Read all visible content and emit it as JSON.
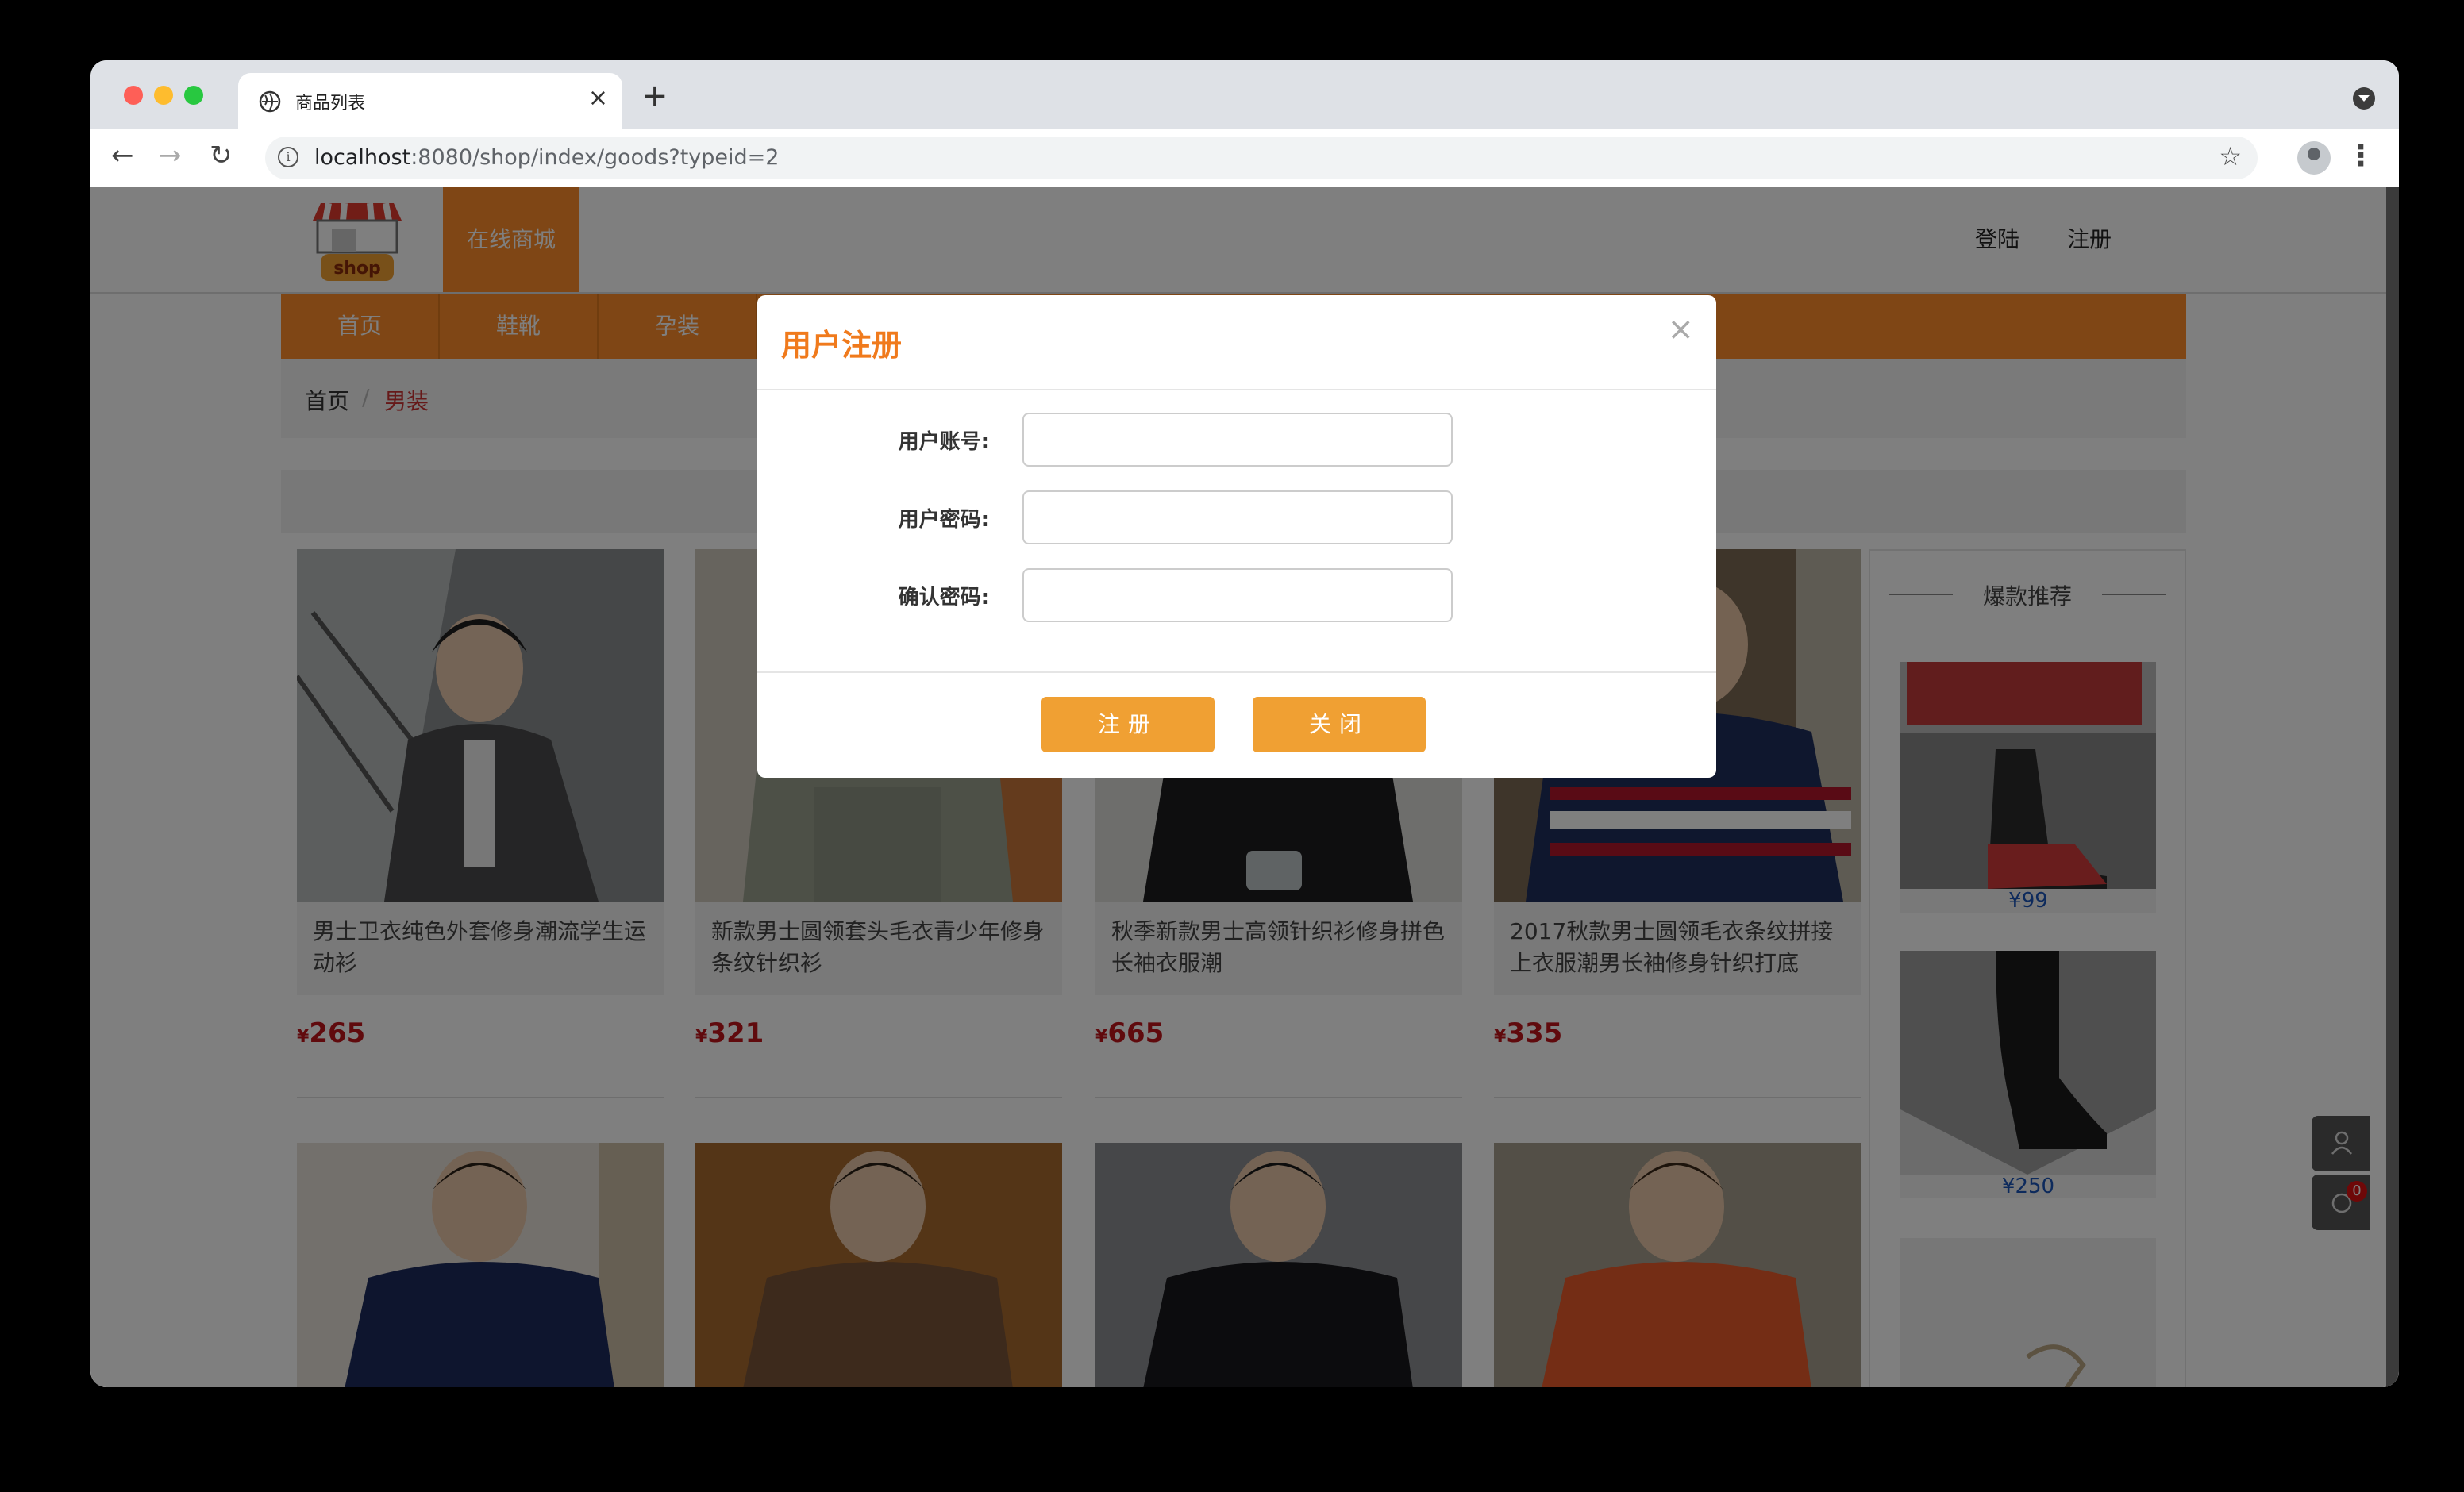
{
  "browser": {
    "tab_title": "商品列表",
    "tab_close": "×",
    "new_tab": "+",
    "url_host": "localhost",
    "url_rest": ":8080/shop/index/goods?typeid=2"
  },
  "header": {
    "logo_text": "shop",
    "brand": "在线商城",
    "login": "登陆",
    "register": "注册"
  },
  "menu": [
    "首页",
    "鞋靴",
    "孕装"
  ],
  "breadcrumb": {
    "home": "首页",
    "separator": "/",
    "current": "男装"
  },
  "products": [
    {
      "name": "男士卫衣纯色外套修身潮流学生运动衫",
      "price": "265"
    },
    {
      "name": "新款男士圆领套头毛衣青少年修身条纹针织衫",
      "price": "321"
    },
    {
      "name": "秋季新款男士高领针织衫修身拼色长袖衣服潮",
      "price": "665"
    },
    {
      "name": "2017秋款男士圆领毛衣条纹拼接上衣服潮男长袖修身针织打底",
      "price": "335"
    }
  ],
  "currency": "¥",
  "sidebar": {
    "title": "爆款推荐",
    "items": [
      {
        "price": "¥99"
      },
      {
        "price": "¥250"
      }
    ]
  },
  "cart_badge": "0",
  "modal": {
    "title": "用户注册",
    "close": "×",
    "fields": [
      {
        "label": "用户账号:",
        "value": ""
      },
      {
        "label": "用户密码:",
        "value": ""
      },
      {
        "label": "确认密码:",
        "value": ""
      }
    ],
    "register_button": "注册",
    "close_button": "关闭"
  }
}
